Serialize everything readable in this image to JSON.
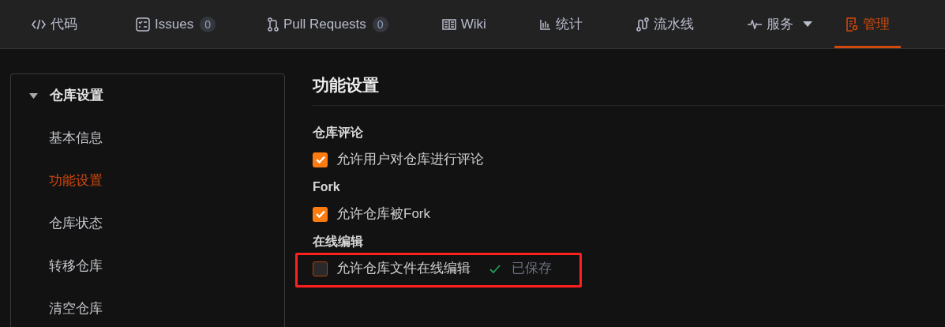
{
  "tabs": [
    {
      "label": "代码",
      "selected": false,
      "dropdown": false
    },
    {
      "label": "Issues",
      "count": "0",
      "selected": false,
      "dropdown": false
    },
    {
      "label": "Pull Requests",
      "count": "0",
      "selected": false,
      "dropdown": false
    },
    {
      "label": "Wiki",
      "selected": false,
      "dropdown": false
    },
    {
      "label": "统计",
      "selected": false,
      "dropdown": false
    },
    {
      "label": "流水线",
      "selected": false,
      "dropdown": false
    },
    {
      "label": "服务",
      "selected": false,
      "dropdown": true
    },
    {
      "label": "管理",
      "selected": true,
      "dropdown": false
    }
  ],
  "sidebar": {
    "group": {
      "label": "仓库设置",
      "expanded": true,
      "items": [
        {
          "label": "基本信息",
          "selected": false
        },
        {
          "label": "功能设置",
          "selected": true
        },
        {
          "label": "仓库状态",
          "selected": false
        },
        {
          "label": "转移仓库",
          "selected": false
        },
        {
          "label": "清空仓库",
          "selected": false
        }
      ]
    }
  },
  "main": {
    "title": "功能设置",
    "sections": [
      {
        "heading": "仓库评论",
        "options": [
          {
            "label": "允许用户对仓库进行评论",
            "checked": true
          }
        ]
      },
      {
        "heading": "Fork",
        "options": [
          {
            "label": "允许仓库被Fork",
            "checked": true
          }
        ]
      },
      {
        "heading": "在线编辑",
        "options": [
          {
            "label": "允许仓库文件在线编辑",
            "checked": false,
            "status": "已保存"
          }
        ]
      }
    ]
  }
}
